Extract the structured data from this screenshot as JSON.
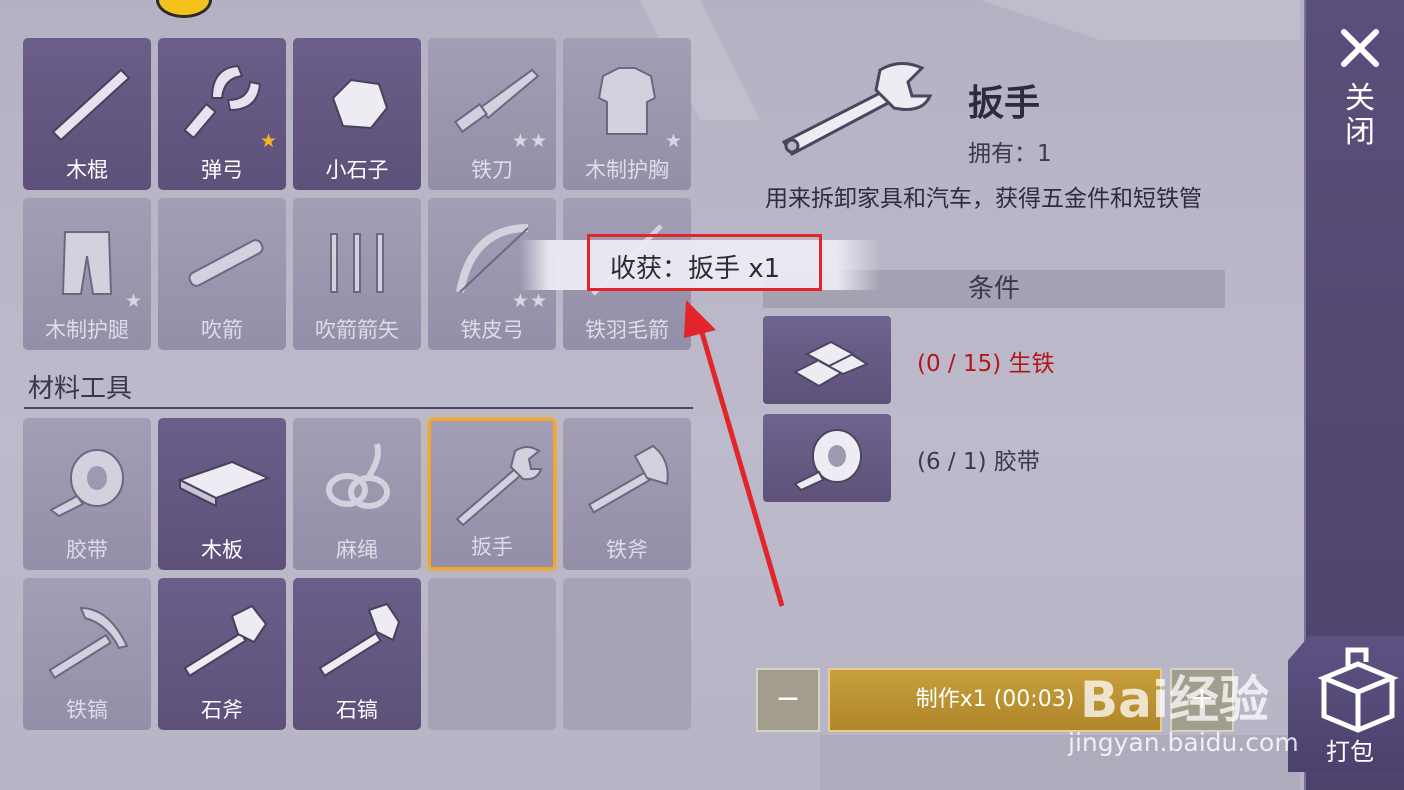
{
  "inventory": {
    "top_items": [
      {
        "label": "木棍",
        "stars": "",
        "icon": "wooden-stick-icon"
      },
      {
        "label": "弹弓",
        "stars": "★",
        "icon": "slingshot-icon"
      },
      {
        "label": "小石子",
        "stars": "",
        "icon": "pebble-icon"
      },
      {
        "label": "铁刀",
        "stars": "★★",
        "icon": "iron-knife-icon"
      },
      {
        "label": "木制护胸",
        "stars": "★",
        "icon": "wooden-chestplate-icon"
      },
      {
        "label": "木制护腿",
        "stars": "★",
        "icon": "wooden-leggings-icon"
      },
      {
        "label": "吹箭",
        "stars": "",
        "icon": "blowgun-icon"
      },
      {
        "label": "吹箭箭矢",
        "stars": "",
        "icon": "blowgun-darts-icon"
      },
      {
        "label": "铁皮弓",
        "stars": "★★",
        "icon": "iron-bow-icon"
      },
      {
        "label": "铁羽毛箭",
        "stars": "",
        "icon": "iron-feather-arrow-icon"
      }
    ],
    "section_title": "材料工具",
    "material_items": [
      {
        "label": "胶带",
        "icon": "tape-icon"
      },
      {
        "label": "木板",
        "icon": "wood-plank-icon"
      },
      {
        "label": "麻绳",
        "icon": "rope-icon"
      },
      {
        "label": "扳手",
        "icon": "wrench-icon"
      },
      {
        "label": "铁斧",
        "icon": "iron-axe-icon"
      },
      {
        "label": "铁镐",
        "icon": "iron-pickaxe-icon"
      },
      {
        "label": "石斧",
        "icon": "stone-axe-icon"
      },
      {
        "label": "石镐",
        "icon": "stone-pickaxe-icon"
      }
    ]
  },
  "detail": {
    "name": "扳手",
    "owned": "拥有：1",
    "description": "用来拆卸家具和汽车，获得五金件和短铁管",
    "conditions_header": "条件",
    "requirements": [
      {
        "text": "(0 / 15) 生铁",
        "color": "#b01818",
        "icon": "iron-ingot-icon"
      },
      {
        "text": "(6 / 1) 胶带",
        "color": "#3b3850",
        "icon": "tape-icon"
      }
    ]
  },
  "toast": {
    "text": "收获：扳手 x1"
  },
  "actions": {
    "minus": "−",
    "craft": "制作x1 (00:03)",
    "plus": "+"
  },
  "side": {
    "close": "关闭",
    "pack": "打包"
  },
  "watermark": {
    "brand": "Bai经验",
    "url": "jingyan.baidu.com"
  },
  "colors": {
    "selected_border": "#f0a72f",
    "annotation_red": "#e2252a",
    "requirement_missing": "#b01818"
  }
}
